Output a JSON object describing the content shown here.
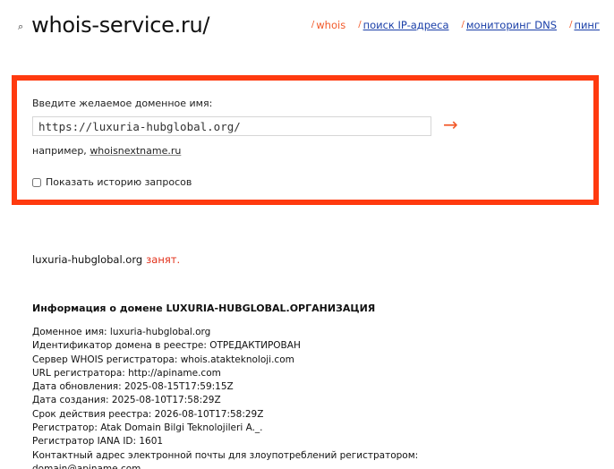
{
  "header": {
    "logo_text": "whois-service.ru/",
    "logo_glyph": "⌕",
    "nav": [
      {
        "label": "whois",
        "active": true
      },
      {
        "label": "поиск IP-адреса",
        "active": false
      },
      {
        "label": "мониторинг DNS",
        "active": false
      },
      {
        "label": "пинг",
        "active": false
      }
    ]
  },
  "search": {
    "label": "Введите желаемое доменное имя:",
    "value": "https://luxuria-hubglobal.org/",
    "submit_glyph": "→",
    "example_prefix": "например,",
    "example_link": "whoisnextname.ru",
    "history_label": "Показать историю запросов",
    "history_checked": false,
    "frame_color": "#ff3a0f"
  },
  "result": {
    "domain": "luxuria-hubglobal.org",
    "status": "занят.",
    "status_color": "#e2301a"
  },
  "info": {
    "title": "Информация о домене LUXURIA-HUBGLOBAL.ОРГАНИЗАЦИЯ",
    "lines": [
      "Доменное имя: luxuria-hubglobal.org",
      "Идентификатор домена в реестре: ОТРЕДАКТИРОВАН",
      "Сервер WHOIS регистратора: whois.atakteknoloji.com",
      "URL регистратора: http://apiname.com",
      "Дата обновления: 2025-08-15T17:59:15Z",
      "Дата создания: 2025-08-10T17:58:29Z",
      "Срок действия реестра: 2026-08-10T17:58:29Z",
      "Регистратор: Atak Domain Bilgi Teknolojileri A._.",
      "Регистратор IANA ID: 1601",
      "Контактный адрес электронной почты для злоупотреблений регистратором:",
      "domain@apiname.com"
    ]
  }
}
